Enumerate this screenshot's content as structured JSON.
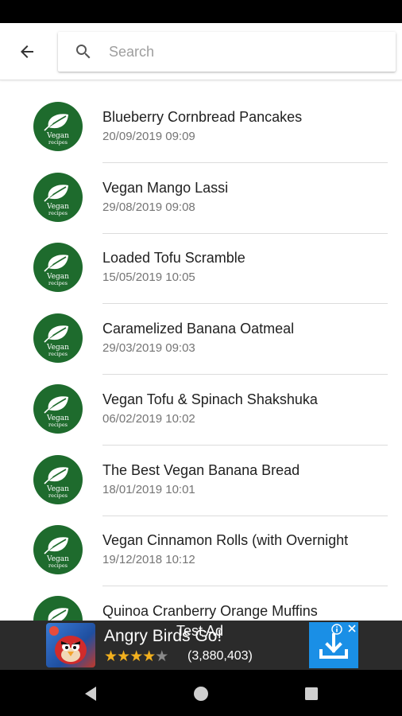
{
  "search": {
    "placeholder": "Search",
    "value": ""
  },
  "recipes": [
    {
      "title": "Blueberry Cornbread Pancakes",
      "date": "20/09/2019 09:09"
    },
    {
      "title": "Vegan Mango Lassi",
      "date": "29/08/2019 09:08"
    },
    {
      "title": "Loaded Tofu Scramble",
      "date": "15/05/2019 10:05"
    },
    {
      "title": "Caramelized Banana Oatmeal",
      "date": "29/03/2019 09:03"
    },
    {
      "title": "Vegan Tofu & Spinach Shakshuka",
      "date": "06/02/2019 10:02"
    },
    {
      "title": "The Best Vegan Banana Bread",
      "date": "18/01/2019 10:01"
    },
    {
      "title": "Vegan Cinnamon Rolls (with Overnight",
      "date": "19/12/2018 10:12"
    },
    {
      "title": "Quinoa Cranberry Orange Muffins",
      "date": ""
    }
  ],
  "avatar_logo": {
    "line1": "Vegan",
    "line2": "recipes"
  },
  "ad": {
    "label": "Test Ad",
    "title": "Angry Birds Go!",
    "rating_count": "(3,880,403)",
    "stars": 4
  },
  "colors": {
    "avatar_bg": "#1e6b2d",
    "ad_download_bg": "#1a8fe6",
    "star": "#f2b01e"
  },
  "icons": {
    "back": "arrow-left-icon",
    "search": "search-icon",
    "nav_back": "triangle-back-icon",
    "nav_home": "circle-home-icon",
    "nav_recents": "square-recents-icon",
    "ad_info": "info-icon",
    "ad_close": "close-icon",
    "ad_download": "download-icon"
  }
}
